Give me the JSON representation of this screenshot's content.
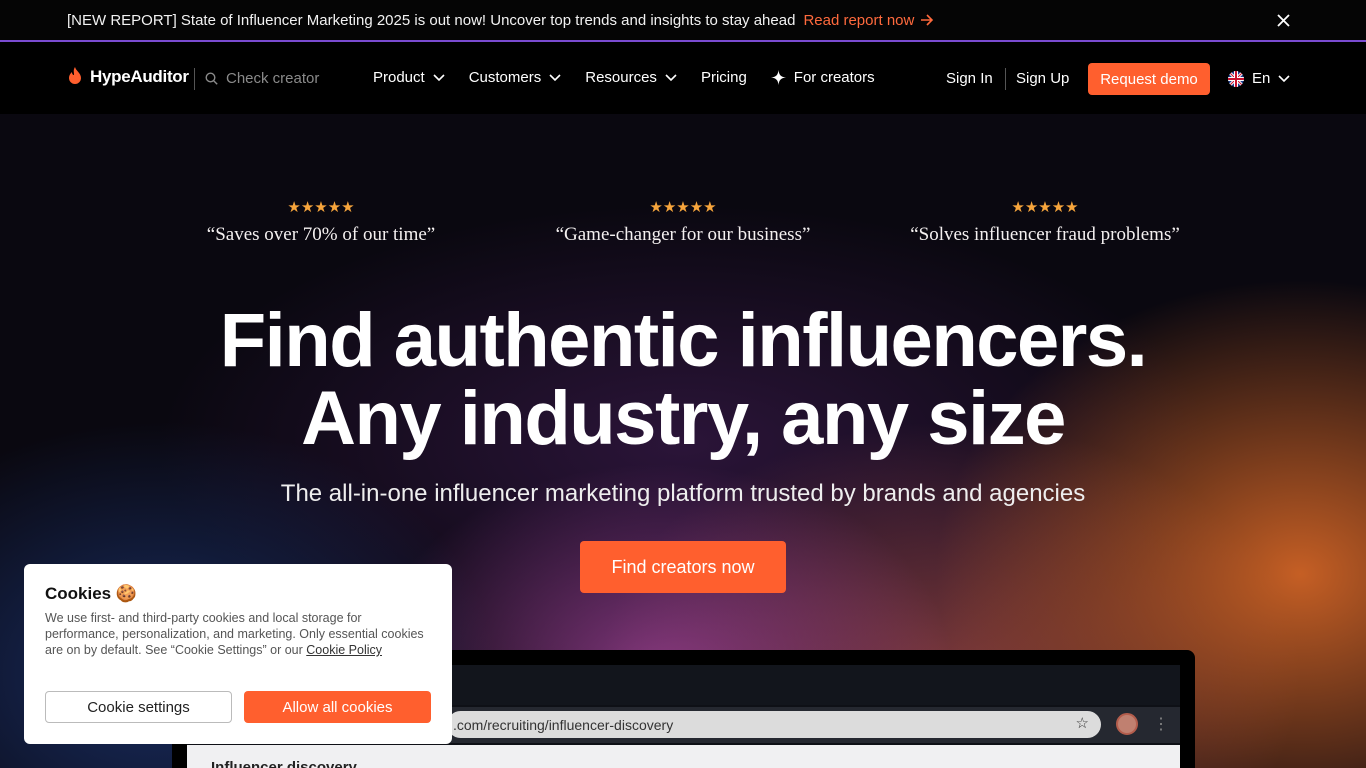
{
  "banner": {
    "text": "[NEW REPORT] State of Influencer Marketing 2025 is out now! Uncover top trends and insights to stay ahead",
    "link_label": "Read report now",
    "close_icon": "close-icon"
  },
  "nav": {
    "logo_text": "HypeAuditor",
    "search_placeholder": "Check creator",
    "items": [
      {
        "label": "Product"
      },
      {
        "label": "Customers"
      },
      {
        "label": "Resources"
      },
      {
        "label": "Pricing"
      },
      {
        "label": "For creators"
      }
    ],
    "sign_in": "Sign In",
    "sign_up": "Sign Up",
    "demo_label": "Request demo",
    "language": "En"
  },
  "reviews": [
    {
      "rating": 5,
      "quote": "“Saves over 70% of our time”"
    },
    {
      "rating": 5,
      "quote": "“Game-changer for our business”"
    },
    {
      "rating": 5,
      "quote": "“Solves influencer fraud problems”"
    }
  ],
  "hero": {
    "headline_line1": "Find authentic influencers.",
    "headline_line2": "Any industry, any size",
    "subline": "The all-in-one influencer marketing platform trusted by brands and agencies",
    "cta_label": "Find creators now"
  },
  "browser_preview": {
    "url_text": ".com/recruiting/influencer-discovery",
    "page_title": "Influencer discovery"
  },
  "cookie": {
    "title": "Cookies 🍪",
    "text": "We use first- and third-party cookies and local storage for performance, personalization, and marketing. Only essential cookies are on by default. See “Cookie Settings” or our ",
    "link_label": "Cookie Policy",
    "settings_label": "Cookie settings",
    "allow_label": "Allow all cookies"
  },
  "colors": {
    "accent": "#ff5f2e",
    "star": "#f7a53c"
  }
}
